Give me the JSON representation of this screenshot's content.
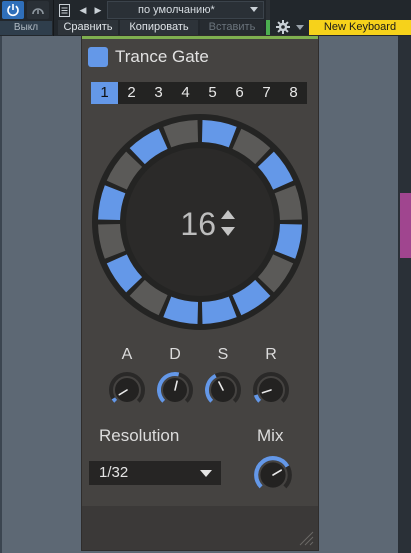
{
  "header": {
    "off_label": "Выкл",
    "preset_name": "по умолчанию*",
    "compare_label": "Сравнить",
    "copy_label": "Копировать",
    "paste_label": "Вставить",
    "keyboard_label": "New Keyboard"
  },
  "icons": {
    "power": "power-icon",
    "bypass": "bypass-icon",
    "file": "file-icon",
    "prev": "arrow-left-icon",
    "next": "arrow-right-icon",
    "gear": "gear-icon",
    "resize": "resize-grip-icon"
  },
  "colors": {
    "accent_blue": "#6498e8",
    "power_blue": "#2f6fba",
    "keyboard_yellow": "#f6d21b",
    "panel": "#454341",
    "side_accent": "#a0458f"
  },
  "plugin": {
    "title": "Trance Gate",
    "steps": [
      "1",
      "2",
      "3",
      "4",
      "5",
      "6",
      "7",
      "8"
    ],
    "active_step": "1",
    "step_count": "16",
    "gate_pattern": [
      1,
      0,
      1,
      0,
      1,
      0,
      1,
      1,
      1,
      0,
      1,
      0,
      1,
      0,
      1,
      0
    ],
    "envelope": {
      "a_label": "A",
      "d_label": "D",
      "s_label": "S",
      "r_label": "R",
      "a_value": 0.05,
      "d_value": 0.55,
      "s_value": 0.4,
      "r_value": 0.1
    },
    "resolution_label": "Resolution",
    "resolution_value": "1/32",
    "mix_label": "Mix",
    "mix_value": 0.72
  }
}
